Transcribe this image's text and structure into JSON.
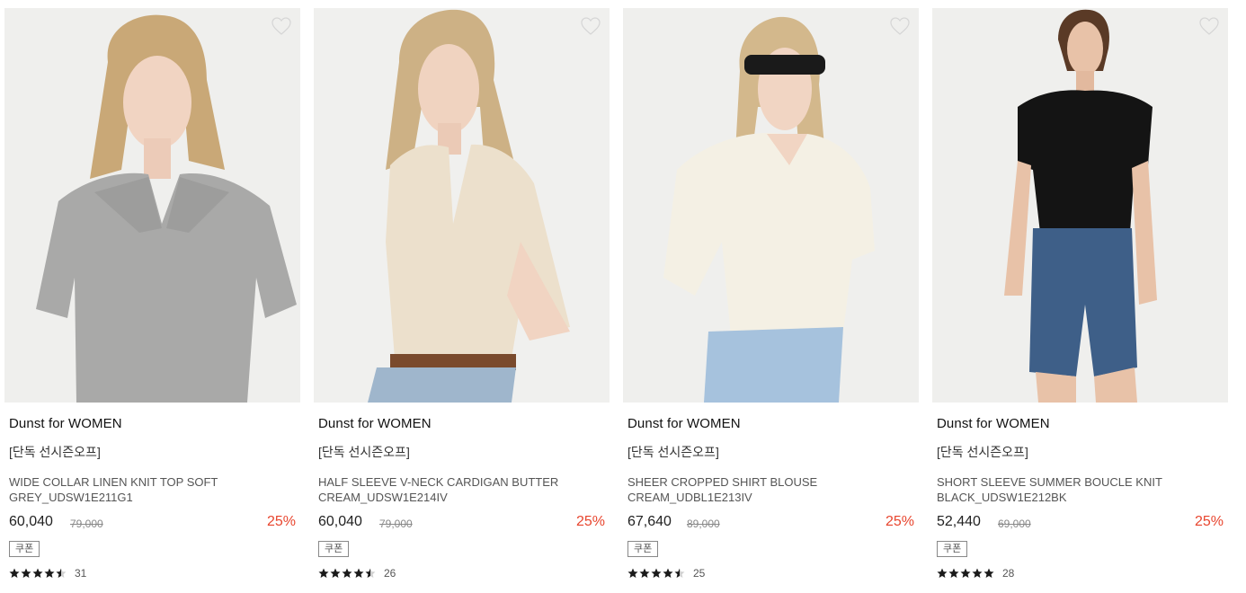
{
  "coupon_label": "쿠폰",
  "accent_discount_color": "#e8452e",
  "products": [
    {
      "brand": "Dunst for WOMEN",
      "promo": "[단독 선시즌오프]",
      "name": "WIDE COLLAR LINEN KNIT TOP SOFT GREY_UDSW1E211G1",
      "price": "60,040",
      "original_price": "79,000",
      "discount": "25%",
      "rating": 4.5,
      "review_count": "31",
      "image": "model in grey collared knit top"
    },
    {
      "brand": "Dunst for WOMEN",
      "promo": "[단독 선시즌오프]",
      "name": "HALF SLEEVE V-NECK CARDIGAN BUTTER CREAM_UDSW1E214IV",
      "price": "60,040",
      "original_price": "79,000",
      "discount": "25%",
      "rating": 4.5,
      "review_count": "26",
      "image": "model in cream v-neck cardigan and jeans"
    },
    {
      "brand": "Dunst for WOMEN",
      "promo": "[단독 선시즌오프]",
      "name": "SHEER CROPPED SHIRT BLOUSE CREAM_UDBL1E213IV",
      "price": "67,640",
      "original_price": "89,000",
      "discount": "25%",
      "rating": 4.5,
      "review_count": "25",
      "image": "model with sunglasses in cream sheer shirt"
    },
    {
      "brand": "Dunst for WOMEN",
      "promo": "[단독 선시즌오프]",
      "name": "SHORT SLEEVE SUMMER BOUCLE KNIT BLACK_UDSW1E212BK",
      "price": "52,440",
      "original_price": "69,000",
      "discount": "25%",
      "rating": 5,
      "review_count": "28",
      "image": "model in black knit top and denim shorts"
    }
  ]
}
